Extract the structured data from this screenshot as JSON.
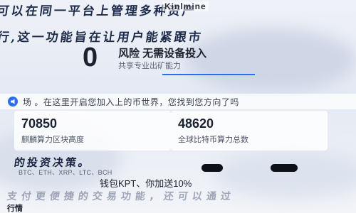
{
  "overlay": {
    "row1": "可以在同一平台上管理多种资产",
    "row2": "行,这一功能旨在让用户能紧跟市",
    "row3": "的投资决策。",
    "row4": "支付更便捷的交易功能，还可以通过"
  },
  "brand": "Kinlmine",
  "intro": {
    "big_number": "0",
    "risk_text": "风险 无需设备投入",
    "sub_text": "共享专业出矿能力"
  },
  "banner": {
    "icon": "announcement-icon",
    "text": "场 。在这里开启您加入上的币世界，您找到您方向了吗"
  },
  "cards": [
    {
      "value": "70850",
      "label": "麒麟算力区块高度"
    },
    {
      "value": "48620",
      "label": "全球比特币算力总数"
    }
  ],
  "coins": {
    "list": "BTC、ETH、XRP、LTC、BCH",
    "feature": "钱包KPT、你加送10%"
  },
  "footer": "行情",
  "colors": {
    "accent": "#2b6ef2",
    "text": "#1e2230"
  }
}
